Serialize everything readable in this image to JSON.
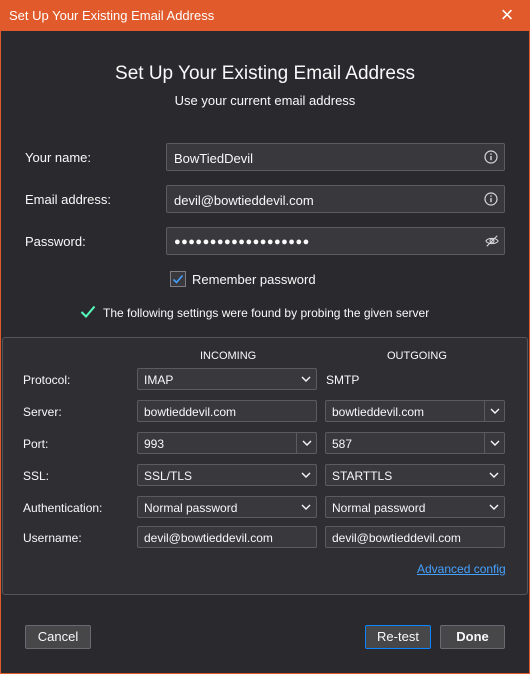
{
  "window": {
    "title": "Set Up Your Existing Email Address",
    "close_glyph": "×"
  },
  "header": {
    "title": "Set Up Your Existing Email Address",
    "subtitle": "Use your current email address"
  },
  "form": {
    "name_label": "Your name:",
    "name_value": "BowTiedDevil",
    "email_label": "Email address:",
    "email_value": "devil@bowtieddevil.com",
    "password_label": "Password:",
    "password_mask": "●●●●●●●●●●●●●●●●●●●",
    "remember_label": "Remember password",
    "remember_checked": true
  },
  "status": {
    "message": "The following settings were found by probing the given server",
    "icon": "checkmark-icon",
    "color": "#54ffbd"
  },
  "config": {
    "incoming_header": "INCOMING",
    "outgoing_header": "OUTGOING",
    "rows": {
      "protocol": {
        "label": "Protocol:",
        "incoming": "IMAP",
        "outgoing": "SMTP"
      },
      "server": {
        "label": "Server:",
        "incoming": "bowtieddevil.com",
        "outgoing": "bowtieddevil.com"
      },
      "port": {
        "label": "Port:",
        "incoming": "993",
        "outgoing": "587"
      },
      "ssl": {
        "label": "SSL:",
        "incoming": "SSL/TLS",
        "outgoing": "STARTTLS"
      },
      "auth": {
        "label": "Authentication:",
        "incoming": "Normal password",
        "outgoing": "Normal password"
      },
      "username": {
        "label": "Username:",
        "incoming": "devil@bowtieddevil.com",
        "outgoing": "devil@bowtieddevil.com"
      }
    },
    "advanced_link": "Advanced config"
  },
  "buttons": {
    "cancel": "Cancel",
    "retest": "Re-test",
    "done": "Done"
  },
  "colors": {
    "titlebar": "#e05a2b",
    "accent_link": "#45a1ff",
    "primary_border": "#0a84ff",
    "background": "#2a2a2e"
  }
}
